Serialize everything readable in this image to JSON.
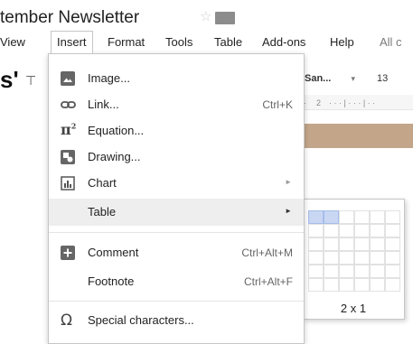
{
  "document": {
    "title": "tember Newsletter"
  },
  "menubar": {
    "items": [
      "View",
      "Insert",
      "Format",
      "Tools",
      "Table",
      "Add-ons",
      "Help",
      "All c"
    ],
    "active": "Insert"
  },
  "toolbar": {
    "font": "San...",
    "font_size": "13",
    "ruler_mark": "2"
  },
  "insert_menu": {
    "items": [
      {
        "label": "Image...",
        "icon": "image-icon"
      },
      {
        "label": "Link...",
        "shortcut": "Ctrl+K",
        "icon": "link-icon"
      },
      {
        "label": "Equation...",
        "icon": "equation-icon"
      },
      {
        "label": "Drawing...",
        "icon": "drawing-icon"
      },
      {
        "label": "Chart",
        "icon": "chart-icon",
        "submenu": true
      },
      {
        "label": "Table",
        "submenu": true,
        "highlighted": true
      },
      {
        "label": "Comment",
        "shortcut": "Ctrl+Alt+M",
        "icon": "comment-icon"
      },
      {
        "label": "Footnote",
        "shortcut": "Ctrl+Alt+F"
      },
      {
        "label": "Special characters...",
        "icon": "omega-icon"
      }
    ]
  },
  "table_picker": {
    "columns": 6,
    "rows": 6,
    "selected_cols": 2,
    "selected_rows": 1,
    "size_label": "2 x 1"
  }
}
